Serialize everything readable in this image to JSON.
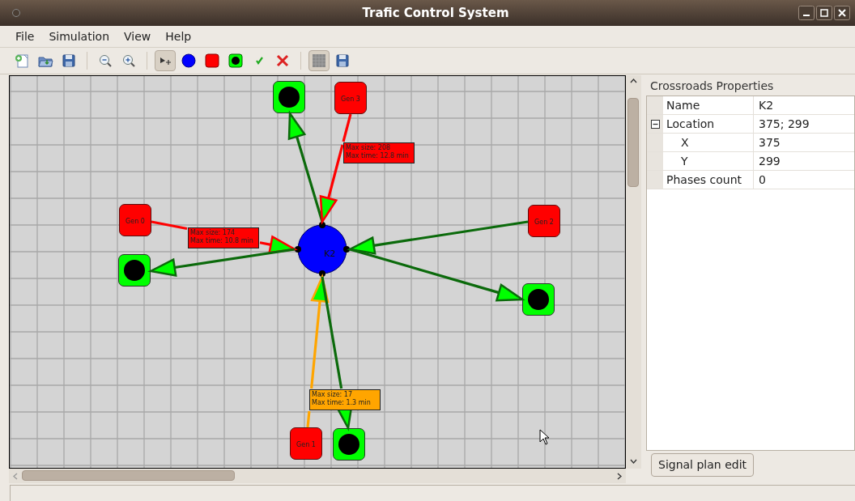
{
  "window": {
    "title": "Trafic Control System"
  },
  "menu": [
    {
      "label": "File"
    },
    {
      "label": "Simulation"
    },
    {
      "label": "View"
    },
    {
      "label": "Help"
    }
  ],
  "toolbar": {
    "groups": [
      [
        {
          "kind": "new",
          "selected": false
        },
        {
          "kind": "open",
          "selected": false
        },
        {
          "kind": "save",
          "selected": false
        }
      ],
      [
        {
          "kind": "zoom-out",
          "selected": false
        },
        {
          "kind": "zoom-in",
          "selected": false
        }
      ],
      [
        {
          "kind": "pointer",
          "selected": true
        },
        {
          "kind": "crossroad",
          "selected": false
        },
        {
          "kind": "generator",
          "selected": false
        },
        {
          "kind": "sink",
          "selected": false
        },
        {
          "kind": "check",
          "selected": false
        },
        {
          "kind": "delete",
          "selected": false
        }
      ],
      [
        {
          "kind": "grid",
          "selected": true
        },
        {
          "kind": "save",
          "selected": false
        }
      ]
    ]
  },
  "canvas": {
    "nodes": [
      {
        "kind": "sink"
      },
      {
        "kind": "generator",
        "label": "Gen 3"
      },
      {
        "kind": "generator",
        "label": "Gen 0"
      },
      {
        "kind": "sink"
      },
      {
        "kind": "crossroad",
        "label": "K2"
      },
      {
        "kind": "generator",
        "label": "Gen 2"
      },
      {
        "kind": "sink"
      },
      {
        "kind": "generator",
        "label": "Gen 1"
      },
      {
        "kind": "sink"
      }
    ],
    "connections": [
      {
        "color": "#0b6a0b"
      },
      {
        "color": "#ff0000",
        "label": [
          "Max size: 208",
          "Max time: 12.8 min"
        ]
      },
      {
        "color": "#ff0000",
        "label": [
          "Max size: 174",
          "Max time: 10.8 min"
        ]
      },
      {
        "color": "#0b6a0b"
      },
      {
        "color": "#0b6a0b"
      },
      {
        "color": "#0b6a0b"
      },
      {
        "color": "#ffa500",
        "label": [
          "Max size: 17",
          "Max time: 1.3 min"
        ]
      },
      {
        "color": "#0b6a0b"
      }
    ]
  },
  "properties": {
    "title": "Crossroads Properties",
    "rows": [
      {
        "name": "Name",
        "value": "K2"
      },
      {
        "name": "Location",
        "value": "375; 299",
        "expanded": true,
        "children": [
          {
            "name": "X",
            "value": "375"
          },
          {
            "name": "Y",
            "value": "299"
          }
        ]
      },
      {
        "name": "Phases count",
        "value": "0"
      }
    ]
  },
  "buttons": [
    {
      "label": "Signal plan edit"
    }
  ]
}
